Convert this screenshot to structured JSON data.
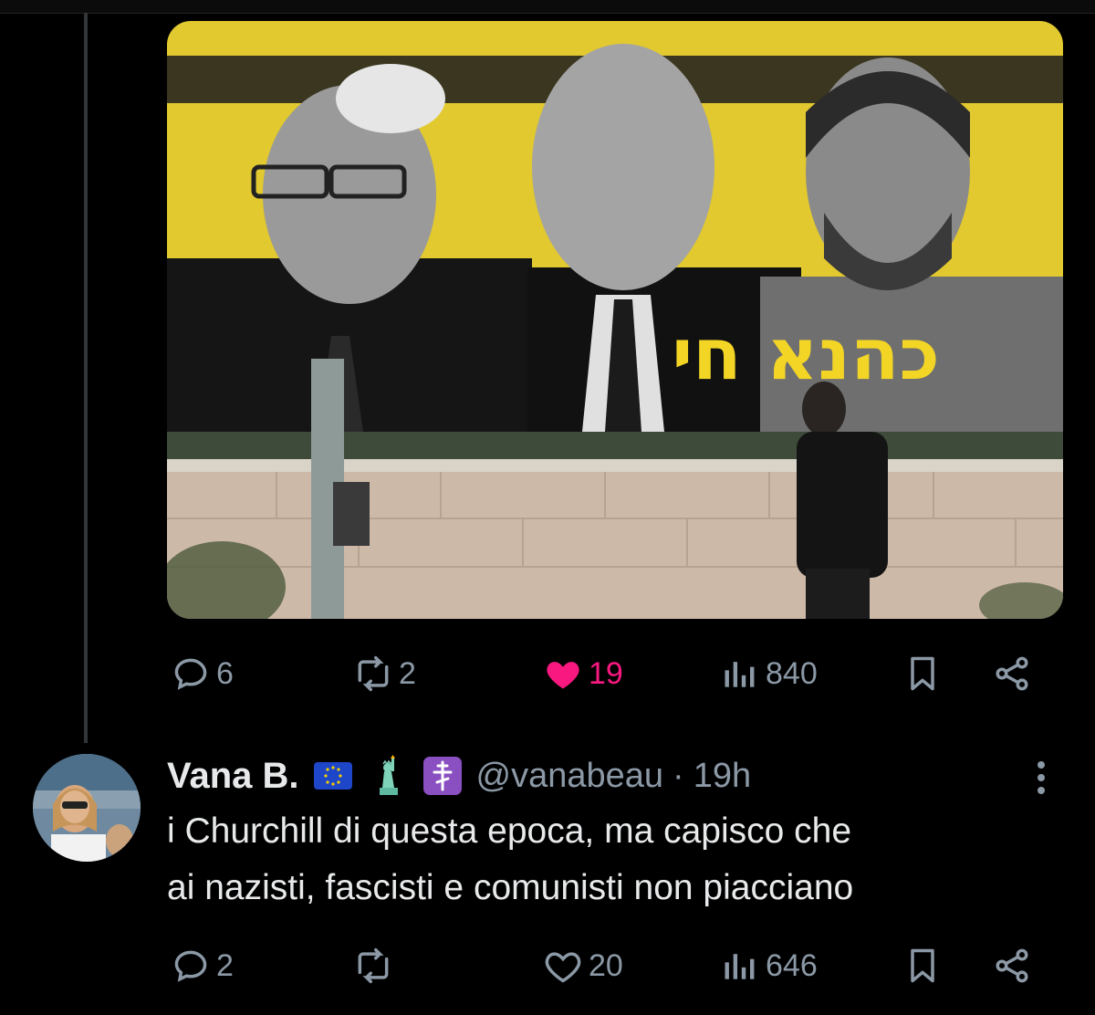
{
  "post": {
    "media": {
      "billboard_text": "כהנא חי"
    },
    "actions": {
      "replies": "6",
      "reposts": "2",
      "likes": "19",
      "views": "840"
    }
  },
  "reply": {
    "display_name": "Vana B.",
    "badges": [
      "eu-flag-emoji",
      "statue-of-liberty-emoji",
      "orthodox-cross-emoji"
    ],
    "handle": "@vanabeau",
    "separator": "·",
    "time": "19h",
    "text_line1": "i Churchill di questa epoca, ma capisco che",
    "text_line2": "ai nazisti, fascisti e comunisti non piacciano",
    "actions": {
      "replies": "2",
      "reposts": "",
      "likes": "20",
      "views": "646"
    }
  },
  "colors": {
    "background": "#000000",
    "text": "#e7e9ea",
    "muted": "#8b98a5",
    "like": "#f91880",
    "billboard_yellow": "#e9d23a"
  }
}
